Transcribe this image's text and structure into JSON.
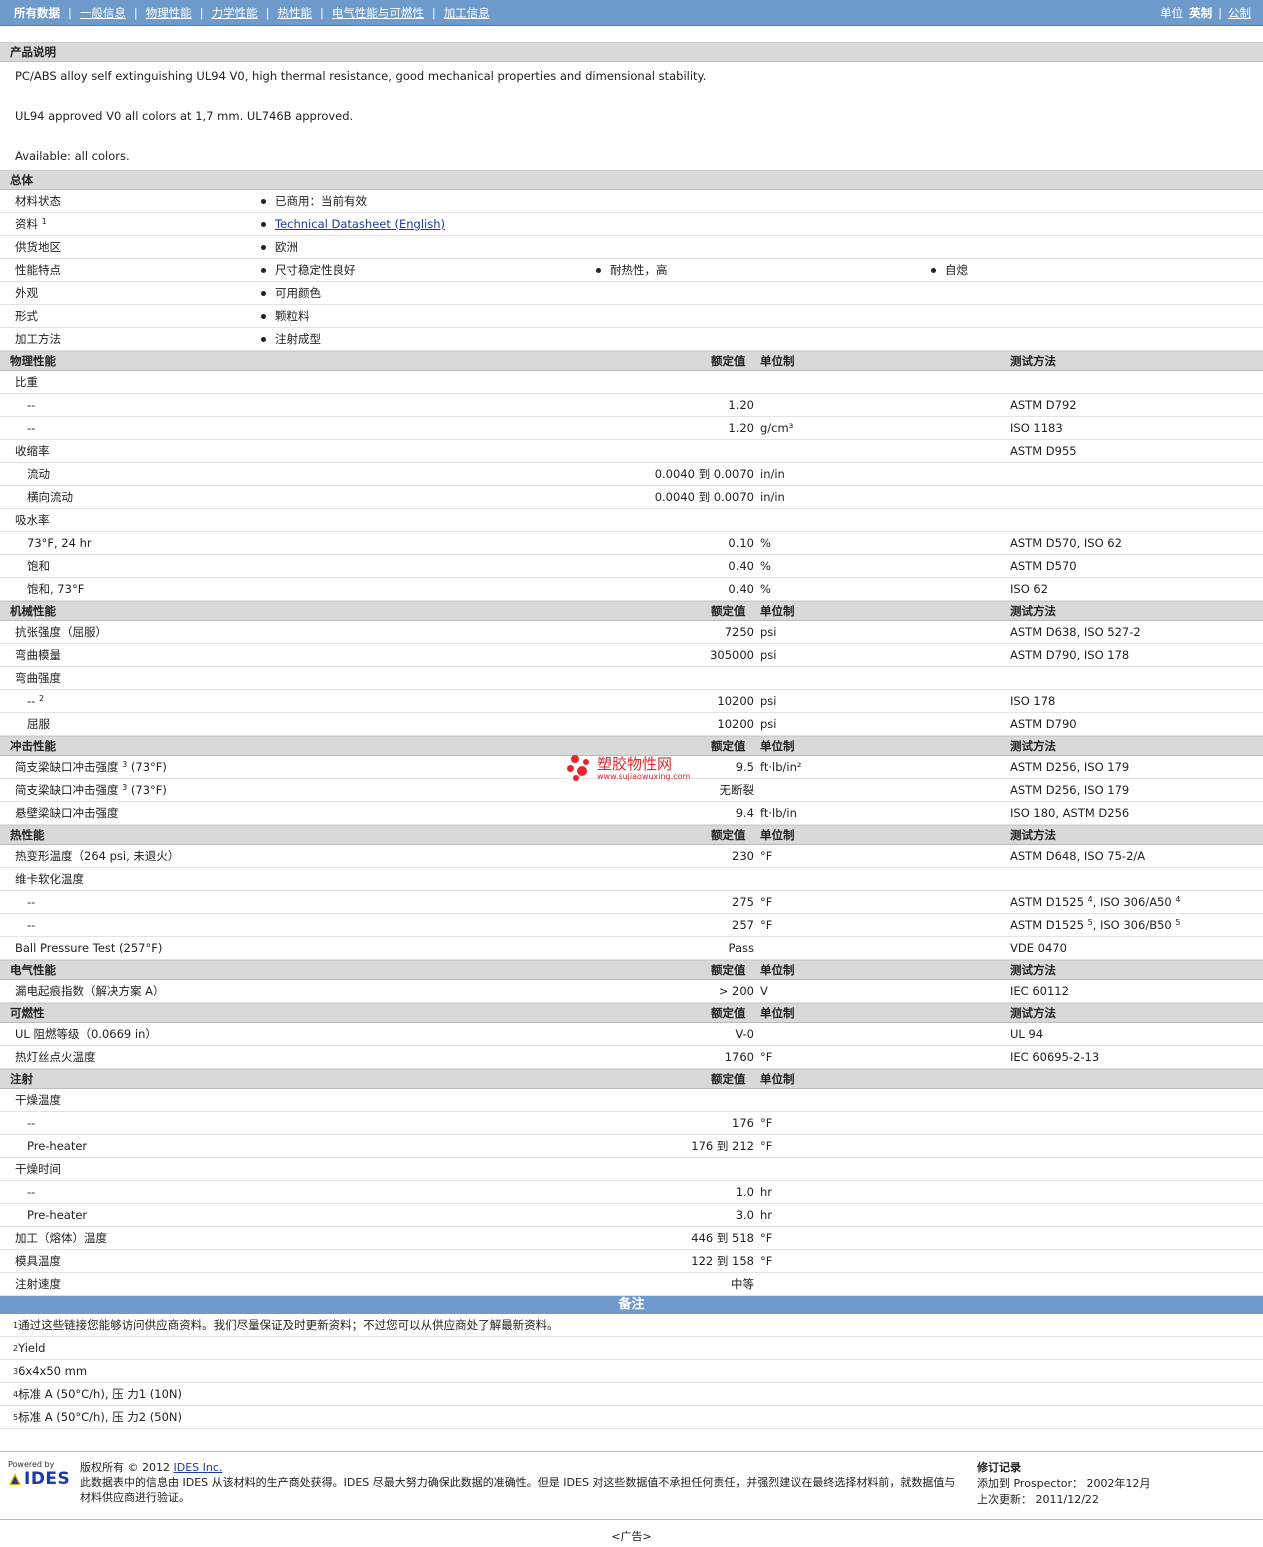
{
  "nav": {
    "items": [
      "所有数据",
      "一般信息",
      "物理性能",
      "力学性能",
      "热性能",
      "电气性能与可燃性",
      "加工信息"
    ],
    "units_label": "单位",
    "unit_active": "英制",
    "unit_other": "公制"
  },
  "description": {
    "title": "产品说明",
    "lines": [
      "PC/ABS alloy self extinguishing UL94 V0, high thermal resistance, good mechanical properties and dimensional stability.",
      "UL94 approved V0 all colors at 1,7 mm. UL746B approved.",
      "Available: all colors."
    ]
  },
  "general": {
    "title": "总体",
    "rows": [
      {
        "label": "材料状态",
        "values": [
          "已商用：当前有效"
        ]
      },
      {
        "label": "资料",
        "sup": "1",
        "values": [
          "Technical Datasheet (English)"
        ],
        "link": true
      },
      {
        "label": "供货地区",
        "values": [
          "欧洲"
        ]
      },
      {
        "label": "性能特点",
        "values": [
          "尺寸稳定性良好",
          "耐热性，高",
          "自熄"
        ]
      },
      {
        "label": "外观",
        "values": [
          "可用颜色"
        ]
      },
      {
        "label": "形式",
        "values": [
          "颗粒料"
        ]
      },
      {
        "label": "加工方法",
        "values": [
          "注射成型"
        ]
      }
    ]
  },
  "col_headers": {
    "value": "额定值",
    "unit": "单位制",
    "test": "测试方法"
  },
  "sections": [
    {
      "title": "物理性能",
      "test_col": true,
      "rows": [
        {
          "label": "比重",
          "value": "",
          "unit": "",
          "test": ""
        },
        {
          "label": "--",
          "indent": true,
          "value": "1.20",
          "unit": "",
          "test": "ASTM D792"
        },
        {
          "label": "--",
          "indent": true,
          "value": "1.20",
          "unit": "g/cm³",
          "test": "ISO 1183"
        },
        {
          "label": "收缩率",
          "value": "",
          "unit": "",
          "test": "ASTM D955"
        },
        {
          "label": "流动",
          "indent": true,
          "value": "0.0040 到  0.0070",
          "unit": "in/in",
          "test": ""
        },
        {
          "label": "横向流动",
          "indent": true,
          "value": "0.0040 到  0.0070",
          "unit": "in/in",
          "test": ""
        },
        {
          "label": "吸水率",
          "value": "",
          "unit": "",
          "test": ""
        },
        {
          "label": "73°F, 24 hr",
          "indent": true,
          "value": "0.10",
          "unit": "%",
          "test": "ASTM D570, ISO 62"
        },
        {
          "label": "饱和",
          "indent": true,
          "value": "0.40",
          "unit": "%",
          "test": "ASTM D570"
        },
        {
          "label": "饱和, 73°F",
          "indent": true,
          "value": "0.40",
          "unit": "%",
          "test": "ISO 62"
        }
      ]
    },
    {
      "title": "机械性能",
      "test_col": true,
      "rows": [
        {
          "label": "抗张强度（屈服）",
          "value": "7250",
          "unit": "psi",
          "test": "ASTM D638, ISO 527-2"
        },
        {
          "label": "弯曲模量",
          "value": "305000",
          "unit": "psi",
          "test": "ASTM D790, ISO 178"
        },
        {
          "label": "弯曲强度",
          "value": "",
          "unit": "",
          "test": ""
        },
        {
          "label": "--",
          "sup": "2",
          "indent": true,
          "value": "10200",
          "unit": "psi",
          "test": "ISO 178"
        },
        {
          "label": "屈服",
          "indent": true,
          "value": "10200",
          "unit": "psi",
          "test": "ASTM D790"
        }
      ]
    },
    {
      "title": "冲击性能",
      "test_col": true,
      "rows": [
        {
          "label": "简支梁缺口冲击强度",
          "sup": "3",
          "suffix": " (73°F)",
          "value": "9.5",
          "unit": "ft·lb/in²",
          "test": "ASTM D256, ISO 179"
        },
        {
          "label": "简支梁缺口冲击强度",
          "sup": "3",
          "suffix": " (73°F)",
          "value": "无断裂",
          "unit": "",
          "test": "ASTM D256, ISO 179"
        },
        {
          "label": "悬壁梁缺口冲击强度",
          "value": "9.4",
          "unit": "ft·lb/in",
          "test": "ISO 180, ASTM D256"
        }
      ]
    },
    {
      "title": "热性能",
      "test_col": true,
      "rows": [
        {
          "label": "热变形温度（264 psi, 未退火）",
          "value": "230",
          "unit": "°F",
          "test": "ASTM D648, ISO 75-2/A"
        },
        {
          "label": "维卡软化温度",
          "value": "",
          "unit": "",
          "test": ""
        },
        {
          "label": "--",
          "indent": true,
          "value": "275",
          "unit": "°F",
          "test": "ASTM D1525",
          "test_sup": "4",
          "test2": ", ISO 306/A50",
          "test2_sup": "4"
        },
        {
          "label": "--",
          "indent": true,
          "value": "257",
          "unit": "°F",
          "test": "ASTM D1525",
          "test_sup": "5",
          "test2": ", ISO 306/B50",
          "test2_sup": "5"
        },
        {
          "label": "Ball Pressure Test (257°F)",
          "value": "Pass",
          "unit": "",
          "test": "VDE 0470"
        }
      ]
    },
    {
      "title": "电气性能",
      "test_col": true,
      "rows": [
        {
          "label": "漏电起痕指数（解决方案 A）",
          "value": "> 200",
          "unit": "V",
          "test": "IEC 60112"
        }
      ]
    },
    {
      "title": "可燃性",
      "test_col": true,
      "rows": [
        {
          "label": "UL 阻燃等级（0.0669 in）",
          "value": "V-0",
          "unit": "",
          "test": "UL 94"
        },
        {
          "label": "热灯丝点火温度",
          "value": "1760",
          "unit": "°F",
          "test": "IEC 60695-2-13"
        }
      ]
    },
    {
      "title": "注射",
      "test_col": false,
      "rows": [
        {
          "label": "干燥温度",
          "value": "",
          "unit": "",
          "test": ""
        },
        {
          "label": "--",
          "indent": true,
          "value": "176",
          "unit": "°F",
          "test": ""
        },
        {
          "label": "Pre-heater",
          "indent": true,
          "value": "176 到  212",
          "unit": "°F",
          "test": ""
        },
        {
          "label": "干燥时间",
          "value": "",
          "unit": "",
          "test": ""
        },
        {
          "label": "--",
          "indent": true,
          "value": "1.0",
          "unit": "hr",
          "test": ""
        },
        {
          "label": "Pre-heater",
          "indent": true,
          "value": "3.0",
          "unit": "hr",
          "test": ""
        },
        {
          "label": "加工（熔体）温度",
          "value": "446 到  518",
          "unit": "°F",
          "test": ""
        },
        {
          "label": "模具温度",
          "value": "122 到  158",
          "unit": "°F",
          "test": ""
        },
        {
          "label": "注射速度",
          "value": "中等",
          "unit": "",
          "test": ""
        }
      ]
    }
  ],
  "notes": {
    "title": "备注",
    "items": [
      {
        "n": "1",
        "text": "通过这些链接您能够访问供应商资料。我们尽量保证及时更新资料；不过您可以从供应商处了解最新资料。"
      },
      {
        "n": "2",
        "text": "Yield"
      },
      {
        "n": "3",
        "text": "6x4x50 mm"
      },
      {
        "n": "4",
        "text": "标准  A (50°C/h), 压  力1 (10N)"
      },
      {
        "n": "5",
        "text": "标准  A (50°C/h), 压  力2 (50N)"
      }
    ]
  },
  "footer": {
    "powered_by": "Powered by",
    "logo_text": "IDES",
    "copyright_prefix": "版权所有  © 2012 ",
    "copyright_link": "IDES Inc.",
    "disclaimer": "此数据表中的信息由  IDES 从该材料的生产商处获得。IDES 尽最大努力确保此数据的准确性。但是  IDES 对这些数据值不承担任何责任，并强烈建议在最终选择材料前，就数据值与材料供应商进行验证。",
    "revision_title": "修订记录",
    "added_label": "添加到  Prospector：",
    "added_value": "2002年12月",
    "updated_label": "上次更新：",
    "updated_value": "2011/12/22"
  },
  "ad": "<广告>",
  "watermark": {
    "text": "塑胶物性网",
    "url": "www.sujiaowuxing.com",
    "color": "#e3262b"
  }
}
